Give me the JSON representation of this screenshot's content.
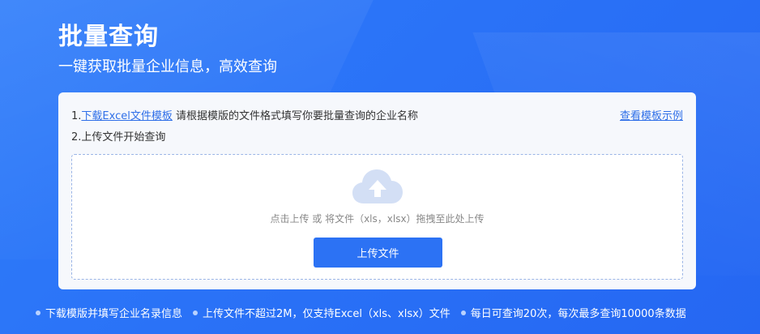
{
  "header": {
    "title": "批量查询",
    "subtitle": "一键获取批量企业信息，高效查询"
  },
  "card": {
    "step1_prefix": "1.",
    "step1_link": "下载Excel文件模板",
    "step1_text": " 请根据模版的文件格式填写你要批量查询的企业名称",
    "step2_text": "2.上传文件开始查询",
    "example_link": "查看模板示例"
  },
  "dropzone": {
    "icon": "cloud-upload-icon",
    "hint": "点击上传 或 将文件（xls，xlsx）拖拽至此处上传",
    "button_label": "上传文件"
  },
  "tips": [
    "下载模版并填写企业名录信息",
    "上传文件不超过2M，仅支持Excel（xls、xlsx）文件",
    "每日可查询20次，每次最多查询10000条数据"
  ],
  "colors": {
    "background": "#2a72f7",
    "primary_button": "#2c72f4",
    "link": "#2f6fe8",
    "cloud_icon": "#d3dff5"
  }
}
